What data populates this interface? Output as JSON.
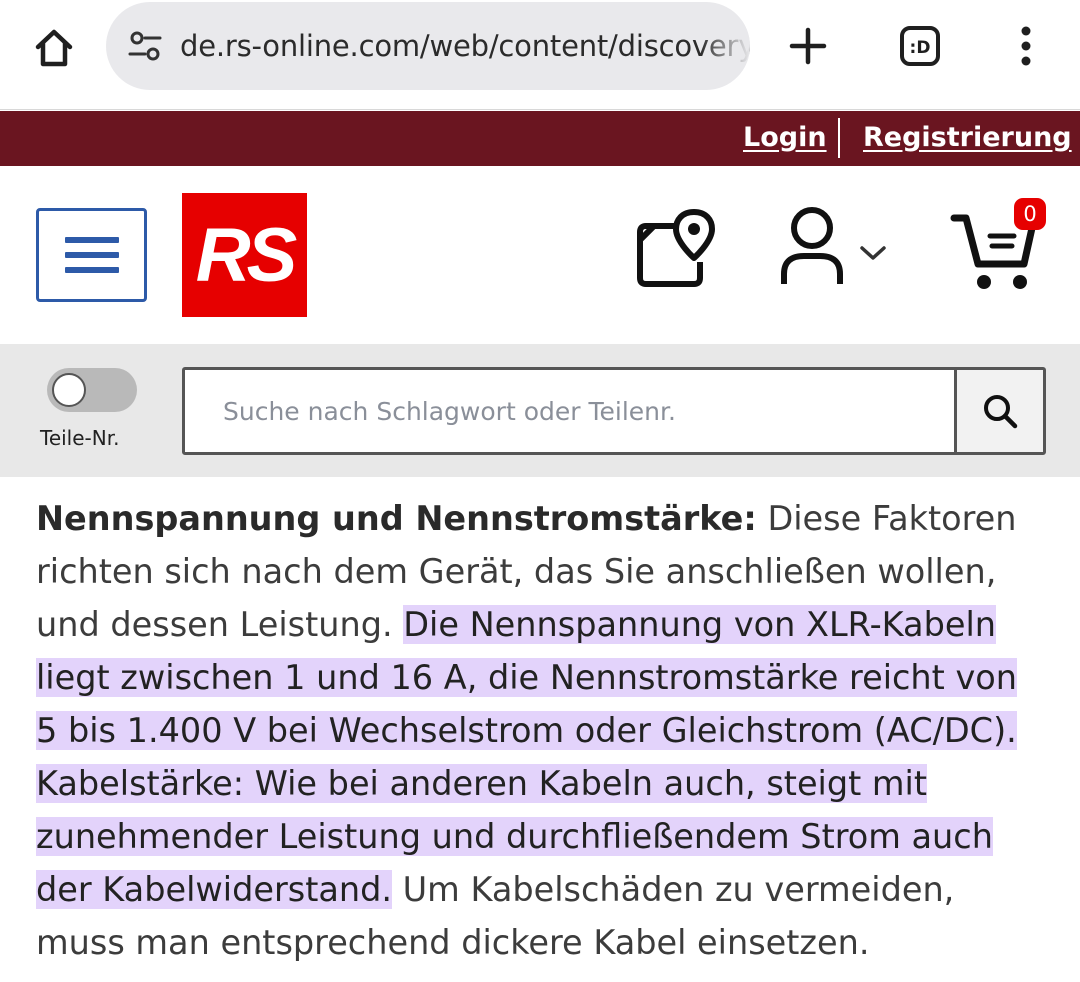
{
  "browser": {
    "url": "de.rs-online.com/web/content/discovery-",
    "home_icon": "home-icon",
    "site_info_icon": "tune-icon",
    "new_tab_icon": "plus-icon",
    "tabs_icon": "tab-switcher-icon",
    "tabs_label": ":D",
    "menu_icon": "more-vert-icon"
  },
  "topbar": {
    "login": "Login",
    "register": "Registrierung",
    "background": "#6a1520"
  },
  "header": {
    "logo_text": "RS",
    "logo_color": "#e60000",
    "menu_icon": "hamburger-icon",
    "store_icon": "store-locator-icon",
    "account_icon": "user-icon",
    "account_chevron": "chevron-down-icon",
    "cart_icon": "cart-icon",
    "cart_count": "0"
  },
  "search": {
    "toggle_label": "Teile-Nr.",
    "placeholder": "Suche nach Schlagwort oder Teilenr.",
    "button_icon": "search-icon"
  },
  "article": {
    "heading": "Nennspannung und Nennstromstärke:",
    "text_1": " Diese Faktoren richten sich nach dem Gerät, das Sie anschließen wollen, und dessen Leistung. ",
    "highlight_1": "Die Nennspannung von XLR-Kabeln liegt zwischen 1 und 16 A, die Nennstromstärke reicht von 5 bis 1.400 V bei Wechselstrom oder Gleichstrom (AC/DC). Kabelstärke: Wie bei anderen Kabeln auch, steigt mit zunehmender Leistung und durchfließendem Strom auch der Kabelwiderstand.",
    "text_2": " Um Kabelschäden zu vermeiden, muss man entsprechend dickere Kabel einsetzen.",
    "highlight_color": "#e3d3fb"
  }
}
